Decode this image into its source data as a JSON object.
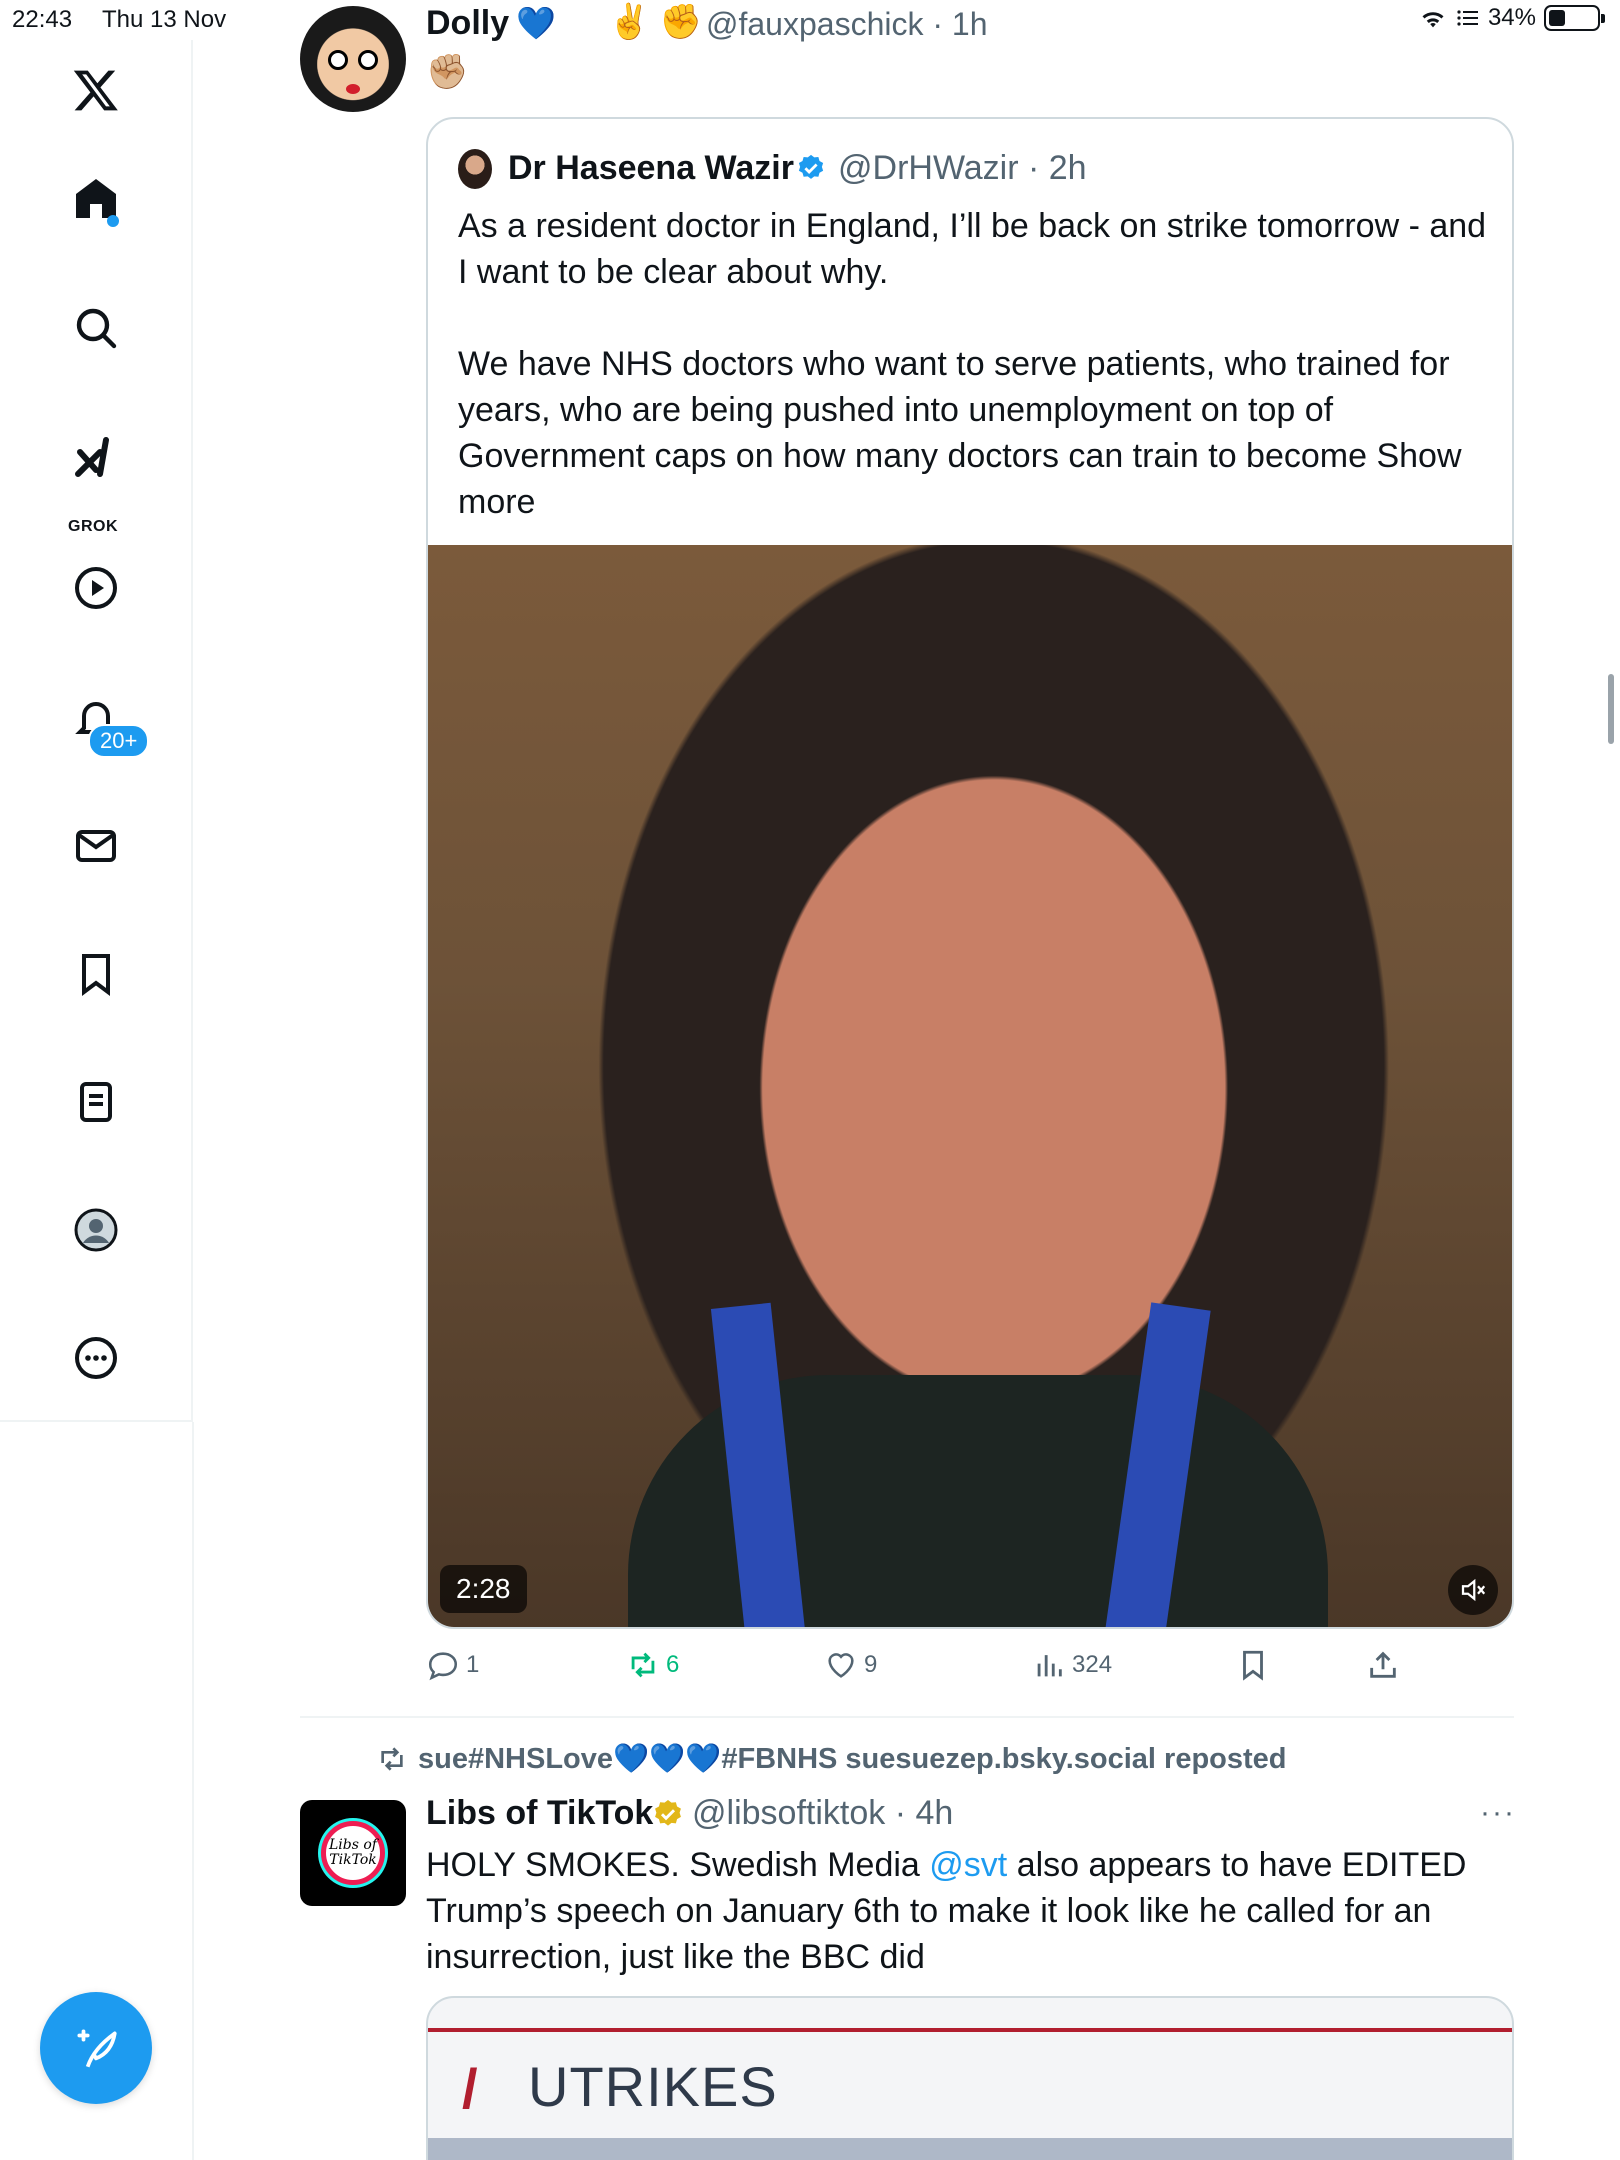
{
  "status_bar": {
    "time": "22:43",
    "date": "Thu 13 Nov",
    "battery": "34%",
    "battery_level": 0.34
  },
  "sidebar": {
    "grok_label": "GROK",
    "notifications_badge": "20+",
    "accent": "#1d9bf0"
  },
  "tweet1": {
    "name": "Dolly",
    "heart": "💙",
    "emojis": "✌️ ✊",
    "handle": "@fauxpaschick · 1h",
    "line2": "✊🏼"
  },
  "quote": {
    "name": "Dr Haseena Wazir",
    "handle": "@DrHWazir · 2h",
    "text": "As a resident doctor in England, I’ll be back on strike tomorrow - and I want to be clear about why.\n\nWe have NHS doctors who want to serve patients, who trained for years, who are being pushed into unemployment on top of Government caps on how many doctors can train to become Show more",
    "video_duration": "2:28"
  },
  "actions": {
    "replies": "1",
    "reposts": "6",
    "likes": "9",
    "views": "324"
  },
  "tweet2": {
    "repost_by": "sue#NHSLove💙💙💙#FBNHS suesuezep.bsky.social reposted",
    "name": "Libs of TikTok",
    "handle": "@libsoftiktok · 4h",
    "more": "···",
    "avatar_text": "Libs of TikTok",
    "text_before": "HOLY SMOKES. Swedish Media ",
    "mention": "@svt",
    "text_after": " also appears to have EDITED Trump’s speech on January 6th to make it look like he called for an insurrection, just like the BBC did",
    "media_heading": "UTRIKES",
    "media_slash": "/"
  }
}
